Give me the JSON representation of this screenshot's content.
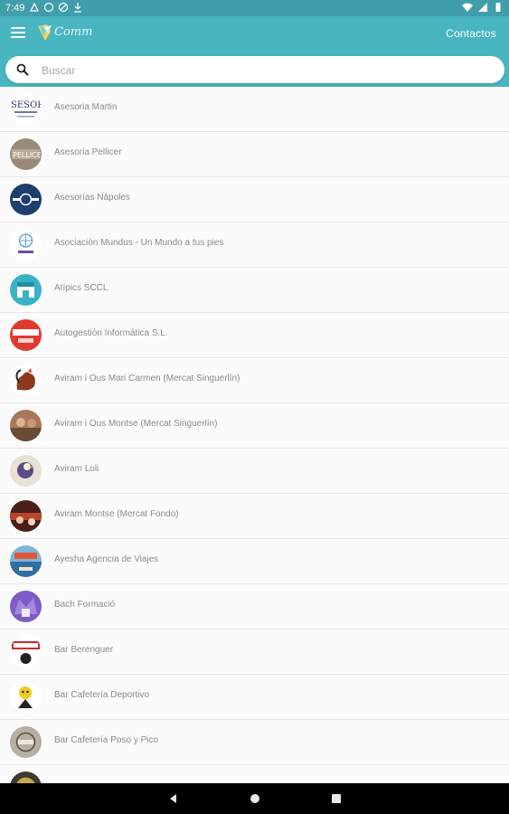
{
  "status_bar": {
    "time": "7:49"
  },
  "app_bar": {
    "logo_text": "Comm",
    "contacts_label": "Contactos",
    "accent_color": "#48b5c1"
  },
  "search": {
    "placeholder": "Buscar",
    "value": ""
  },
  "contacts": [
    {
      "name": "Asesoria Martin",
      "avatar": "sesoria-logo"
    },
    {
      "name": "Asesoria Pellicer",
      "avatar": "pellicer-logo"
    },
    {
      "name": "Asesorías Nápoles",
      "avatar": "napoles-logo"
    },
    {
      "name": "Asociación Mundus - Un Mundo a tus pies",
      "avatar": "mundus-logo"
    },
    {
      "name": "Atípics SCCL",
      "avatar": "shop-logo"
    },
    {
      "name": "Autogestión Informática S.L.",
      "avatar": "autogestion-logo"
    },
    {
      "name": "Aviram i Ous Mari Carmen (Mercat Singuerlín)",
      "avatar": "rooster-logo"
    },
    {
      "name": "Aviram i Ous Montse (Mercat Singuerlín)",
      "avatar": "market-photo"
    },
    {
      "name": "Aviram Loli",
      "avatar": "chicken-logo"
    },
    {
      "name": "Aviram Montse (Mercat Fondo)",
      "avatar": "stall-photo"
    },
    {
      "name": "Ayesha Agencia de Viajes",
      "avatar": "travel-photo"
    },
    {
      "name": "Bach Formació",
      "avatar": "bach-logo"
    },
    {
      "name": "Bar Berenguer",
      "avatar": "berenguer-logo"
    },
    {
      "name": "Bar Cafetería Deportivo",
      "avatar": "deportivo-logo"
    },
    {
      "name": "Bar Cafetería Poso y Pico",
      "avatar": "poso-logo"
    },
    {
      "name": "",
      "avatar": "partial-logo"
    }
  ]
}
